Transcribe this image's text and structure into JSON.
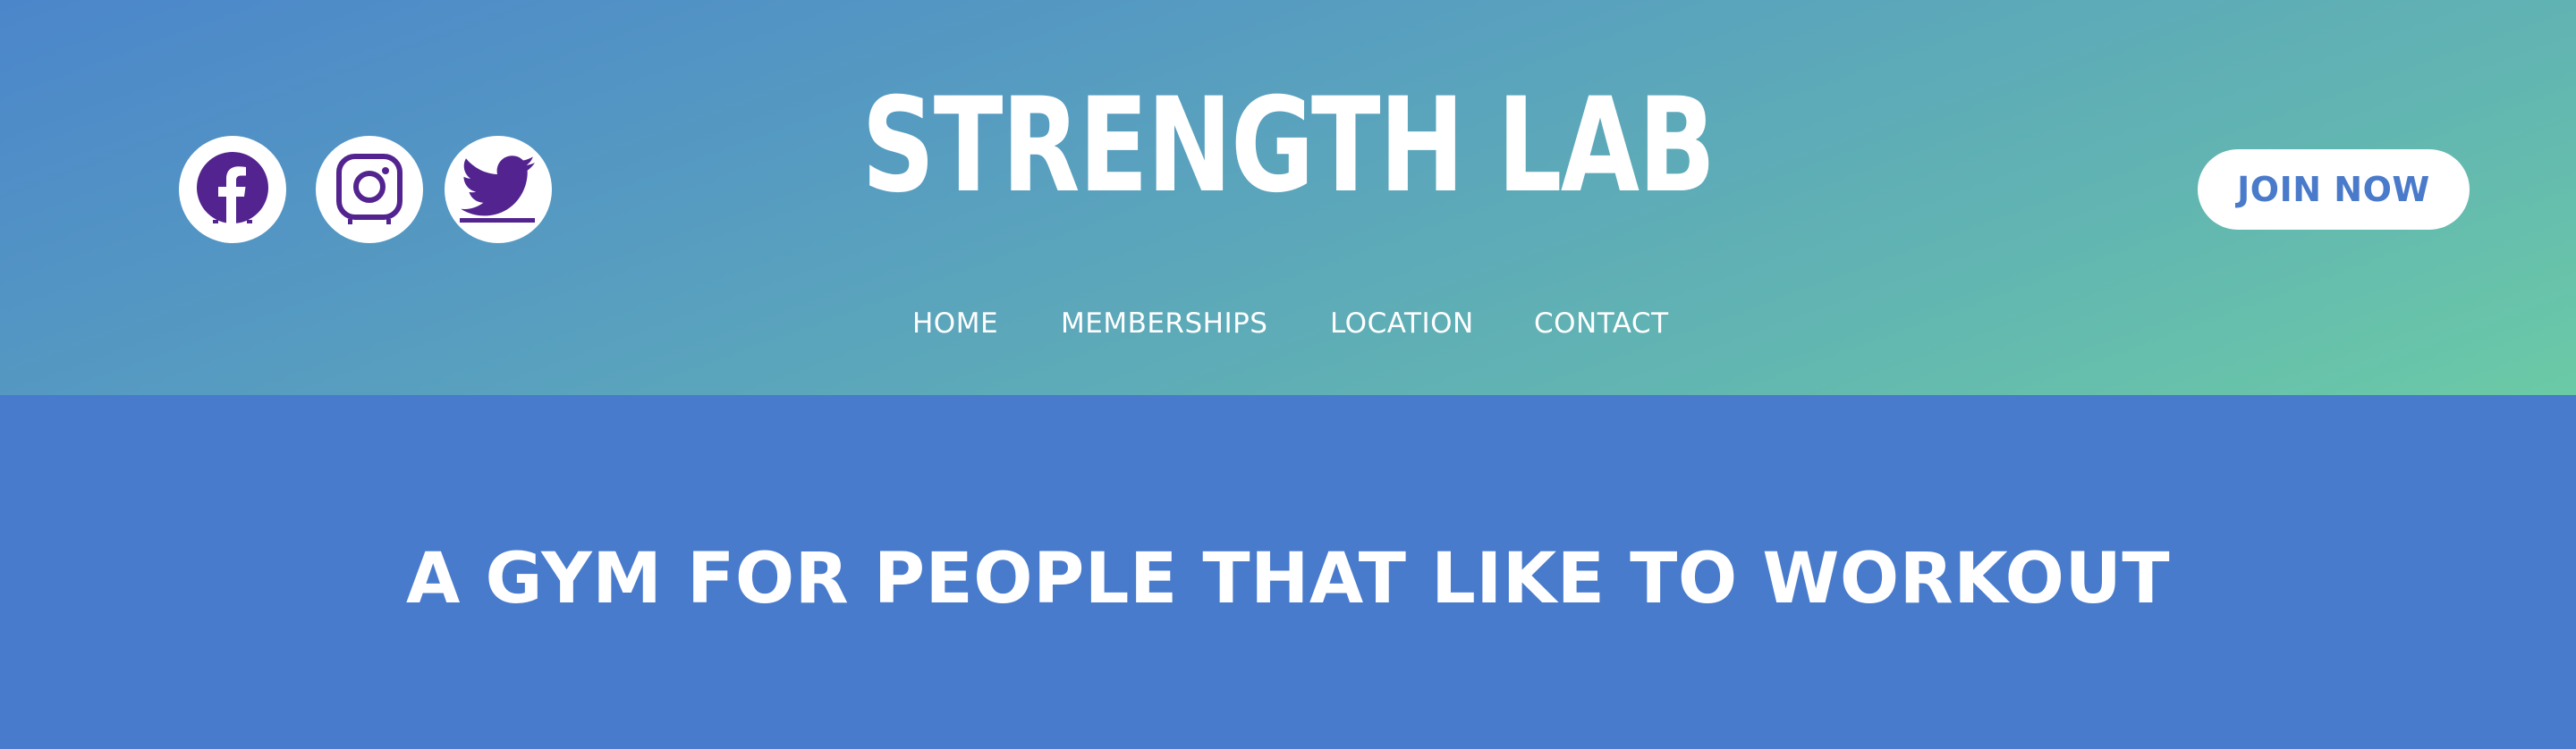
{
  "header": {
    "site_title": "STRENGTH LAB",
    "join_button_label": "JOIN NOW",
    "socials": [
      {
        "icon": "facebook-icon"
      },
      {
        "icon": "instagram-icon"
      },
      {
        "icon": "twitter-icon"
      }
    ],
    "nav": {
      "items": [
        {
          "label": "HOME"
        },
        {
          "label": "MEMBERSHIPS"
        },
        {
          "label": "LOCATION"
        },
        {
          "label": "CONTACT"
        }
      ]
    }
  },
  "hero": {
    "headline": "A GYM FOR PEOPLE THAT LIKE TO WORKOUT"
  },
  "colors": {
    "background": "#497bcd",
    "header_gradient_start": "#4b86cb",
    "header_gradient_end": "#6bcaa6",
    "icon_purple": "#53238f",
    "button_text": "#4a7bcb",
    "white": "#ffffff"
  }
}
